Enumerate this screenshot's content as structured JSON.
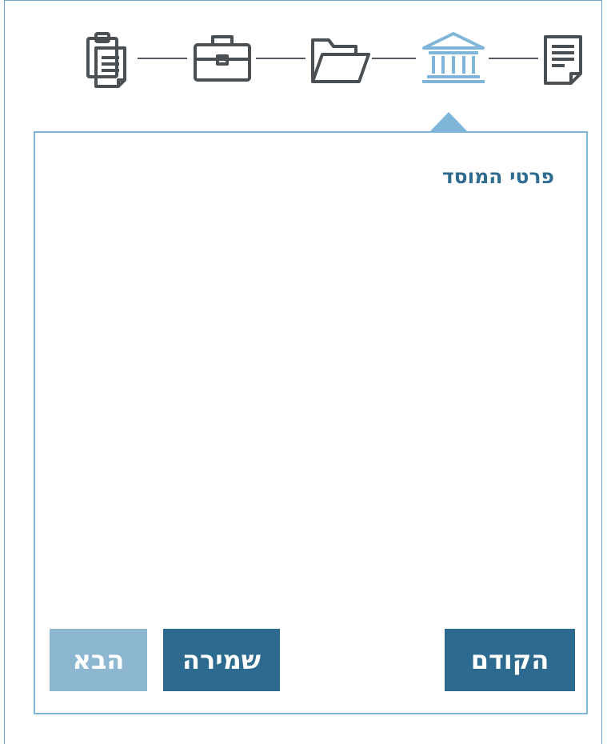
{
  "stepper": {
    "steps": [
      {
        "name": "clipboard",
        "icon": "clipboard-icon",
        "active": false
      },
      {
        "name": "briefcase",
        "icon": "briefcase-icon",
        "active": false
      },
      {
        "name": "folder",
        "icon": "folder-icon",
        "active": false
      },
      {
        "name": "institution",
        "icon": "institution-icon",
        "active": true
      },
      {
        "name": "document",
        "icon": "document-icon",
        "active": false
      }
    ],
    "active_color": "#7fb5d8",
    "inactive_color": "#4a4f54"
  },
  "panel": {
    "title": "פרטי המוסד"
  },
  "buttons": {
    "prev_label": "הקודם",
    "save_label": "שמירה",
    "next_label": "הבא"
  },
  "colors": {
    "primary": "#2d6a8f",
    "disabled": "#8db7d1",
    "border": "#7fb5d8",
    "title": "#2f6b8e"
  }
}
